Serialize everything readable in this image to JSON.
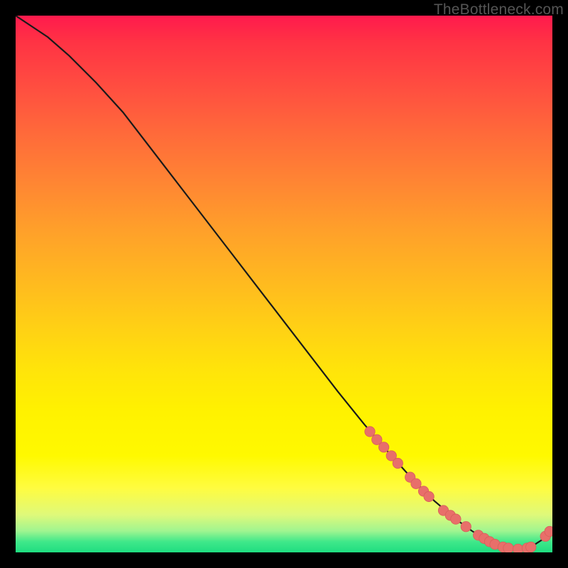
{
  "watermark": "TheBottleneck.com",
  "colors": {
    "curve_stroke": "#1a1a1a",
    "marker_fill": "#e86f6a",
    "marker_stroke": "#d85f5a"
  },
  "chart_data": {
    "type": "line",
    "title": "",
    "xlabel": "",
    "ylabel": "",
    "xlim": [
      0,
      100
    ],
    "ylim": [
      0,
      100
    ],
    "series": [
      {
        "name": "curve",
        "x": [
          0,
          3,
          6,
          10,
          15,
          20,
          25,
          30,
          35,
          40,
          45,
          50,
          55,
          60,
          65,
          70,
          74,
          78,
          82,
          85,
          88,
          90,
          92,
          94,
          96,
          98,
          100
        ],
        "y": [
          100,
          98,
          96,
          92.5,
          87.5,
          82,
          75.5,
          69,
          62.5,
          56,
          49.5,
          43,
          36.5,
          30,
          23.8,
          18,
          13.6,
          9.6,
          6.2,
          4.0,
          2.2,
          1.3,
          0.8,
          0.6,
          1.0,
          2.3,
          4.4
        ]
      }
    ],
    "markers": [
      {
        "x": 66.0,
        "y": 22.5
      },
      {
        "x": 67.3,
        "y": 21.0
      },
      {
        "x": 68.6,
        "y": 19.6
      },
      {
        "x": 70.0,
        "y": 18.0
      },
      {
        "x": 71.2,
        "y": 16.6
      },
      {
        "x": 73.5,
        "y": 14.0
      },
      {
        "x": 74.6,
        "y": 12.8
      },
      {
        "x": 76.0,
        "y": 11.4
      },
      {
        "x": 77.0,
        "y": 10.4
      },
      {
        "x": 79.7,
        "y": 7.8
      },
      {
        "x": 81.0,
        "y": 6.9
      },
      {
        "x": 82.0,
        "y": 6.2
      },
      {
        "x": 83.9,
        "y": 4.8
      },
      {
        "x": 86.2,
        "y": 3.2
      },
      {
        "x": 87.3,
        "y": 2.6
      },
      {
        "x": 88.3,
        "y": 2.0
      },
      {
        "x": 89.3,
        "y": 1.5
      },
      {
        "x": 90.8,
        "y": 1.0
      },
      {
        "x": 91.8,
        "y": 0.8
      },
      {
        "x": 93.6,
        "y": 0.6
      },
      {
        "x": 95.3,
        "y": 0.8
      },
      {
        "x": 96.0,
        "y": 1.0
      },
      {
        "x": 98.7,
        "y": 3.0
      },
      {
        "x": 99.5,
        "y": 3.9
      }
    ]
  }
}
